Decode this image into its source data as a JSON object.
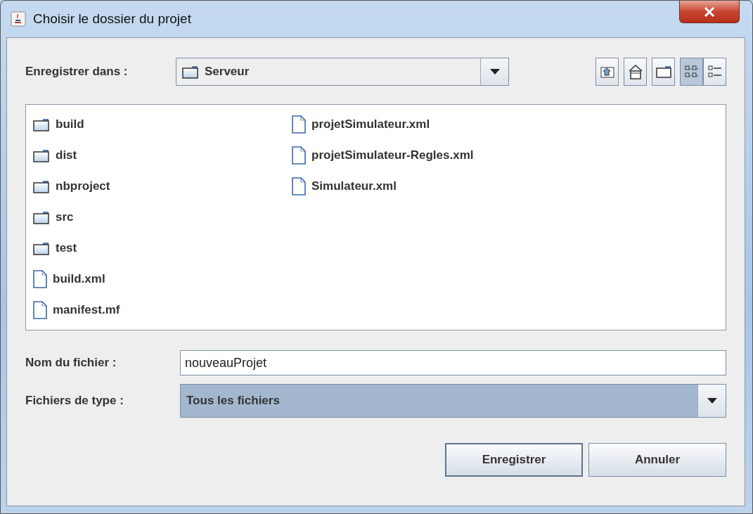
{
  "window": {
    "title": "Choisir le dossier du projet"
  },
  "save_in": {
    "label": "Enregistrer dans :",
    "value": "Serveur"
  },
  "toolbar": [
    {
      "kind": "up",
      "selected": false
    },
    {
      "kind": "home",
      "selected": false
    },
    {
      "kind": "new-folder",
      "selected": false
    },
    {
      "kind": "list",
      "selected": true
    },
    {
      "kind": "details",
      "selected": false
    }
  ],
  "files": [
    {
      "name": "build",
      "kind": "folder"
    },
    {
      "name": "dist",
      "kind": "folder"
    },
    {
      "name": "nbproject",
      "kind": "folder"
    },
    {
      "name": "src",
      "kind": "folder"
    },
    {
      "name": "test",
      "kind": "folder"
    },
    {
      "name": "build.xml",
      "kind": "file"
    },
    {
      "name": "manifest.mf",
      "kind": "file"
    },
    {
      "name": "projetSimulateur.xml",
      "kind": "file"
    },
    {
      "name": "projetSimulateur-Regles.xml",
      "kind": "file"
    },
    {
      "name": "Simulateur.xml",
      "kind": "file"
    }
  ],
  "file_name": {
    "label": "Nom du fichier :",
    "value": "nouveauProjet"
  },
  "file_type": {
    "label": "Fichiers de type :",
    "value": "Tous les fichiers"
  },
  "buttons": [
    {
      "label": "Enregistrer",
      "default": true
    },
    {
      "label": "Annuler",
      "default": false
    }
  ]
}
